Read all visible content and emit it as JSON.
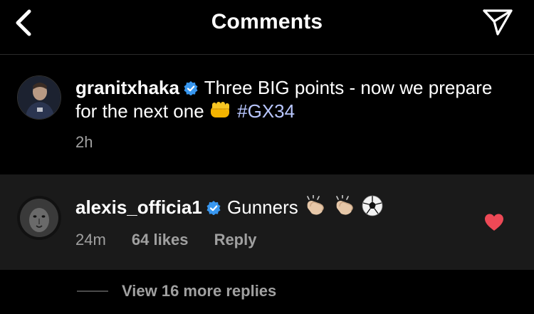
{
  "header": {
    "title": "Comments",
    "back_icon": "chevron-left-icon",
    "send_icon": "paper-plane-icon"
  },
  "caption": {
    "username": "granitxhaka",
    "verified": true,
    "text": "Three BIG points - now we prepare for the next one",
    "emoji": "fist-emoji",
    "hashtag": "#GX34",
    "time": "2h"
  },
  "comment": {
    "username": "alexis_officia1",
    "verified": true,
    "text": "Gunners",
    "emojis": [
      "clapping-hands-emoji",
      "clapping-hands-emoji",
      "soccer-ball-emoji"
    ],
    "time": "24m",
    "likes": "64 likes",
    "reply_label": "Reply",
    "liked": true
  },
  "replies": {
    "label": "View 16 more replies"
  },
  "colors": {
    "background": "#000000",
    "comment_background": "#1a1a1a",
    "secondary_text": "#a0a0a0",
    "hashtag": "#b9c7ff",
    "verified_blue": "#3897f0",
    "like_red": "#ed4956"
  }
}
